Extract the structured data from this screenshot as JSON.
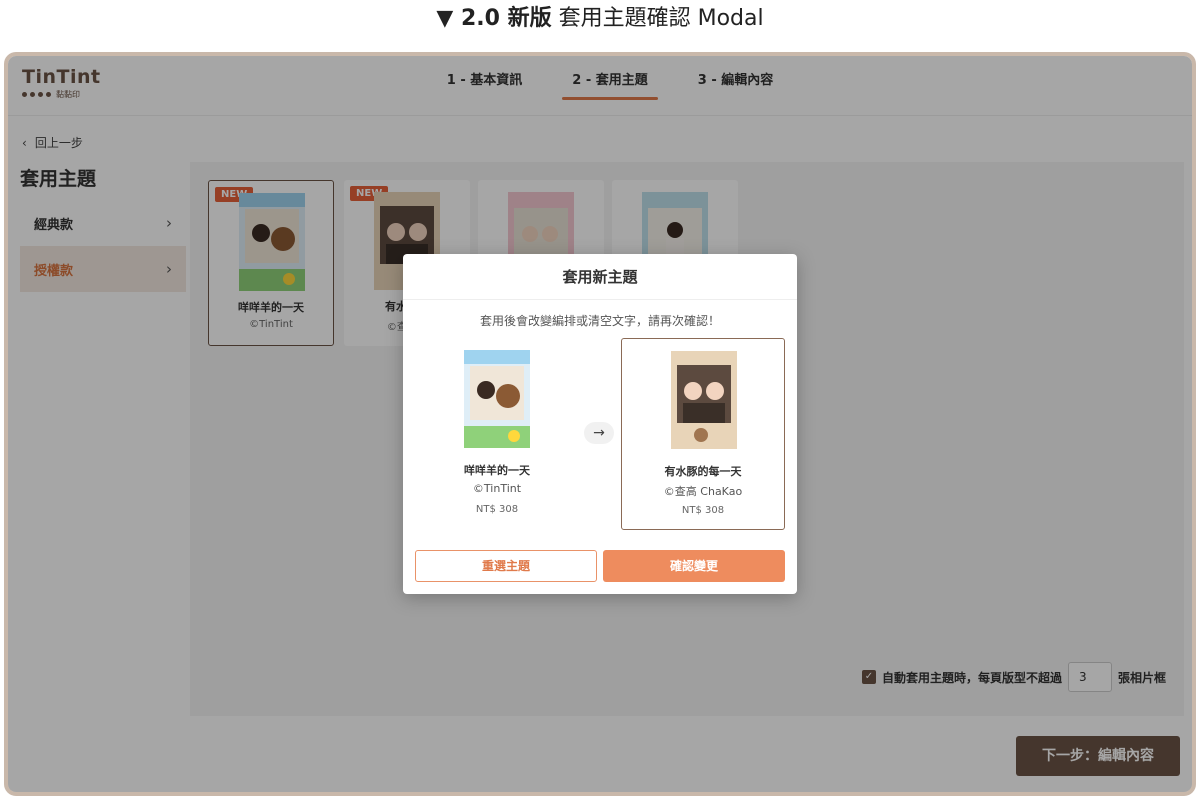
{
  "caption": {
    "prefix": "▼ 2.0 新版",
    "suffix": "套用主題確認 Modal"
  },
  "brand": {
    "name": "TinTint",
    "sub": "黏黏印"
  },
  "steps": [
    "1 - 基本資訊",
    "2 - 套用主題",
    "3 - 編輯內容"
  ],
  "back_label": "回上一步",
  "page_title": "套用主題",
  "sidebar": [
    "經典款",
    "授權款"
  ],
  "cards": [
    {
      "badge": "NEW",
      "name": "咩咩羊的一天",
      "copyright": "©TinTint"
    },
    {
      "badge": "NEW",
      "name": "有水豚的",
      "copyright": "©查高 C"
    },
    {
      "badge": "",
      "name": "",
      "copyright": ""
    },
    {
      "badge": "",
      "name": "",
      "copyright": ""
    }
  ],
  "auto_apply": {
    "prefix": "自動套用主題時，每頁版型不超過",
    "value": "3",
    "suffix": "張相片框"
  },
  "next_label": "下一步：編輯內容",
  "modal": {
    "title": "套用新主題",
    "desc": "套用後會改變編排或清空文字，請再次確認！",
    "from": {
      "name": "咩咩羊的一天",
      "copyright": "©TinTint",
      "price": "NT$ 308"
    },
    "to": {
      "name": "有水豚的每一天",
      "copyright": "©查高 ChaKao",
      "price": "NT$ 308"
    },
    "cancel_label": "重選主題",
    "confirm_label": "確認變更"
  },
  "colors": {
    "brand": "#6b5446",
    "accent": "#e07a4b",
    "new_badge": "#e6613a"
  }
}
